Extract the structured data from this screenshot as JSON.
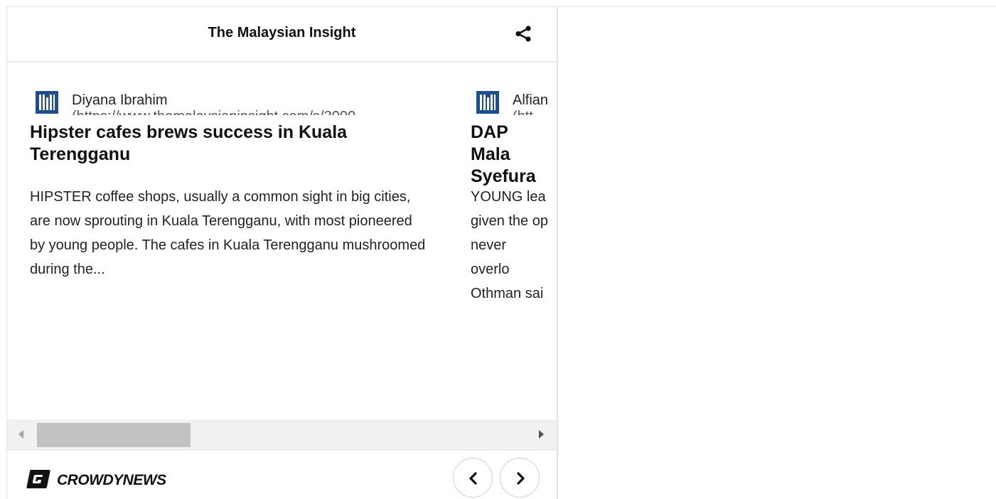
{
  "header": {
    "title": "The Malaysian Insight",
    "share_icon": "share-icon"
  },
  "articles": [
    {
      "author": "Diyana Ibrahim",
      "source_text": "(https://www.themalaysianinsight.com/s/3090",
      "title": "Hipster cafes brews success in Kuala Terengganu",
      "excerpt": "HIPSTER coffee shops, usually a common sight in big cities, are now sprouting in Kuala Terengganu, with most pioneered by young people. The cafes in Kuala Terengganu mushroomed during the..."
    },
    {
      "author": "Alfian",
      "source_text": "(htt",
      "title": "DAP Mala Syefura",
      "excerpt": "YOUNG lea given the op never overlo Othman sai"
    }
  ],
  "footer": {
    "brand": "CROWDYNEWS",
    "prev_icon": "chevron-left-icon",
    "next_icon": "chevron-right-icon"
  },
  "colors": {
    "logo_blue": "#1f4e8c",
    "text": "#222222",
    "scrollbar_thumb": "#c1c1c1"
  }
}
